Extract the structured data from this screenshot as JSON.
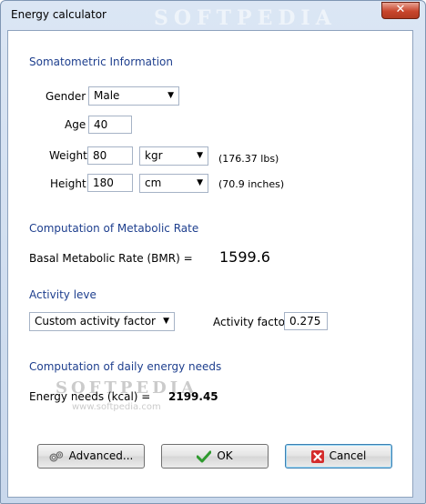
{
  "window": {
    "title": "Energy calculator",
    "watermark": "SOFTPEDIA",
    "close_glyph": "✕"
  },
  "somatometric": {
    "heading": "Somatometric Information",
    "gender_label": "Gender",
    "gender_value": "Male",
    "age_label": "Age",
    "age_value": "40",
    "weight_label": "Weight",
    "weight_value": "80",
    "weight_unit": "kgr",
    "weight_converted": "(176.37 lbs)",
    "height_label": "Height",
    "height_value": "180",
    "height_unit": "cm",
    "height_converted": "(70.9 inches)"
  },
  "metabolic": {
    "heading": "Computation of Metabolic Rate",
    "bmr_label": "Basal Metabolic Rate (BMR) =",
    "bmr_value": "1599.6"
  },
  "activity": {
    "heading": "Activity leve",
    "level_value": "Custom activity factor",
    "factor_label": "Activity factor",
    "factor_value": "0.275"
  },
  "daily": {
    "heading": "Computation of daily energy needs",
    "energy_label": "Energy needs (kcal) =",
    "energy_value": "2199.45",
    "watermark": "SOFTPEDIA",
    "watermark_url": "www.softpedia.com"
  },
  "buttons": {
    "advanced": "Advanced...",
    "ok": "OK",
    "cancel": "Cancel"
  },
  "icons": {
    "advanced": "gears-icon",
    "ok": "checkmark-icon",
    "cancel": "x-icon",
    "dropdown": "chevron-down-icon"
  },
  "colors": {
    "section_heading": "#1e3f8e",
    "ok_check": "#2e9a2e",
    "cancel_x": "#d42b2b"
  }
}
